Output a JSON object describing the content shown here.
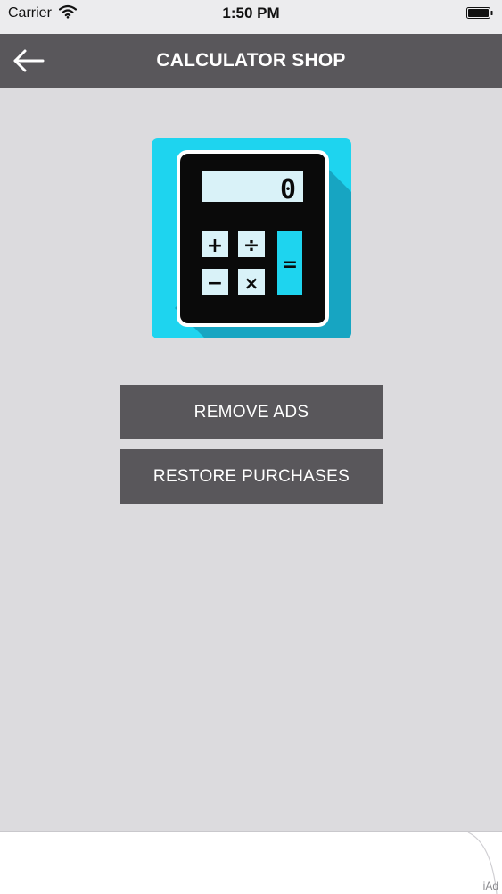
{
  "status_bar": {
    "carrier": "Carrier",
    "time": "1:50 PM",
    "wifi_icon": "wifi-icon",
    "battery_icon": "battery-icon"
  },
  "nav": {
    "title": "CALCULATOR SHOP",
    "back_icon": "back-arrow-icon"
  },
  "app_icon": {
    "display_value": "0",
    "keys": [
      "+",
      "÷",
      "−",
      "×",
      "="
    ],
    "colors": {
      "tile": "#1ed4ef",
      "body": "#0a0a0a",
      "screen": "#d9f2f8",
      "shadow": "#17a5c2"
    }
  },
  "actions": {
    "remove_ads": "REMOVE ADS",
    "restore_purchases": "RESTORE PURCHASES"
  },
  "ad_banner": {
    "label": "iAd"
  },
  "colors": {
    "background": "#dcdbde",
    "nav_bar": "#59575b",
    "button": "#59575b",
    "button_text": "#ffffff"
  }
}
